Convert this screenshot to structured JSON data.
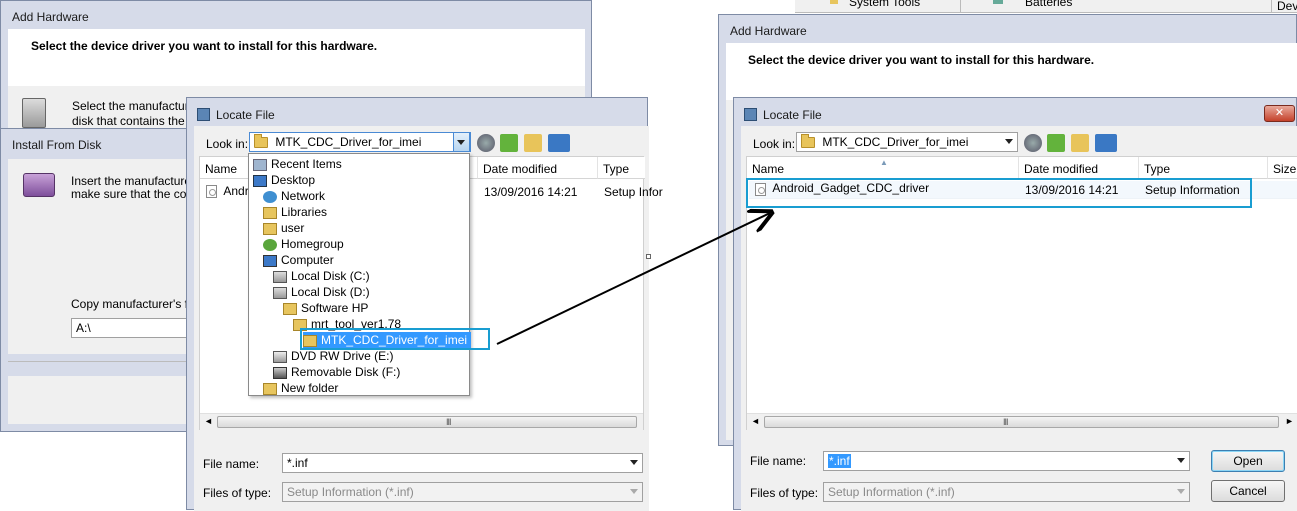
{
  "add_hardware_left": {
    "title": "Add Hardware",
    "heading": "Select the device driver you want to install for this hardware.",
    "text_line1": "Select the manufactur",
    "text_line2": "disk that contains the"
  },
  "install_from_disk": {
    "title": "Install From Disk",
    "text_line1": "Insert the manufacturer's",
    "text_line2": "make sure that the corre",
    "copy_label": "Copy manufacturer's files",
    "copy_value": "A:\\"
  },
  "locate_left": {
    "title": "Locate File",
    "look_in_label": "Look in:",
    "look_in_value": "MTK_CDC_Driver_for_imei",
    "columns": [
      "Name",
      "Date modified",
      "Type"
    ],
    "file_name_partial": "Andro",
    "file_date": "13/09/2016 14:21",
    "file_type_partial": "Setup Infor",
    "dropdown": [
      {
        "label": "Recent Items",
        "icon": "recent-items-icon"
      },
      {
        "label": "Desktop",
        "icon": "desktop-icon"
      },
      {
        "label": "Network",
        "icon": "network-icon"
      },
      {
        "label": "Libraries",
        "icon": "libraries-icon"
      },
      {
        "label": "user",
        "icon": "user-folder-icon"
      },
      {
        "label": "Homegroup",
        "icon": "homegroup-icon"
      },
      {
        "label": "Computer",
        "icon": "computer-icon"
      },
      {
        "label": "Local Disk (C:)",
        "icon": "disk-c-icon"
      },
      {
        "label": "Local Disk (D:)",
        "icon": "disk-d-icon"
      },
      {
        "label": "Software HP",
        "icon": "folder-icon"
      },
      {
        "label": "mrt_tool_ver1.78",
        "icon": "folder-icon"
      },
      {
        "label": "MTK_CDC_Driver_for_imei",
        "icon": "folder-icon"
      },
      {
        "label": "DVD RW Drive (E:)",
        "icon": "dvd-drive-icon"
      },
      {
        "label": "Removable Disk (F:)",
        "icon": "removable-disk-icon"
      },
      {
        "label": "New folder",
        "icon": "folder-icon"
      }
    ],
    "file_name_label": "File name:",
    "file_name_value": "*.inf",
    "files_of_type_label": "Files of type:",
    "files_of_type_value": "Setup Information (*.inf)"
  },
  "add_hardware_right": {
    "title": "Add Hardware",
    "heading": "Select the device driver you want to install for this hardware."
  },
  "top_right_fragments": {
    "system_tools": "System Tools",
    "batteries": "Batteries",
    "dev": "Dev"
  },
  "locate_right": {
    "title": "Locate File",
    "look_in_label": "Look in:",
    "look_in_value": "MTK_CDC_Driver_for_imei",
    "columns": [
      "Name",
      "Date modified",
      "Type",
      "Size"
    ],
    "file": {
      "name": "Android_Gadget_CDC_driver",
      "date": "13/09/2016 14:21",
      "type": "Setup Information"
    },
    "file_name_label": "File name:",
    "file_name_value": "*.inf",
    "files_of_type_label": "Files of type:",
    "files_of_type_value": "Setup Information (*.inf)",
    "open_label": "Open",
    "cancel_label": "Cancel"
  },
  "colors": {
    "highlight": "#199dd1",
    "frame": "#d6dbe9",
    "selection": "#3399ff"
  }
}
